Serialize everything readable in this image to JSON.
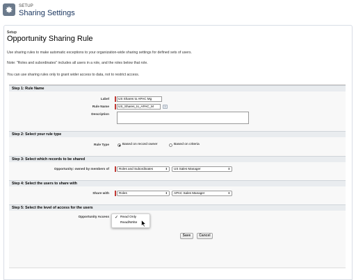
{
  "header": {
    "section": "SETUP",
    "title": "Sharing Settings"
  },
  "page": {
    "setup_label": "Setup",
    "title": "Opportunity Sharing Rule",
    "intro": "Use sharing rules to make automatic exceptions to your organization-wide sharing settings for defined sets of users.",
    "note": "Note: \"Roles and subordinates\" includes all users in a role, and the roles below that role.",
    "grant": "You can use sharing rules only to grant wider access to data, not to restrict access."
  },
  "step1": {
    "heading": "Step 1: Rule Name",
    "label_label": "Label",
    "label_value": "US Shares to APAC Mg",
    "rule_name_label": "Rule Name",
    "rule_name_value": "US_Shares_to_APAC_M",
    "info_icon": "i",
    "description_label": "Description",
    "description_value": ""
  },
  "step2": {
    "heading": "Step 2: Select your rule type",
    "rule_type_label": "Rule Type",
    "option_owner": "Based on record owner",
    "option_criteria": "Based on criteria",
    "selected": "owner"
  },
  "step3": {
    "heading": "Step 3: Select which records to be shared",
    "owned_by_label": "Opportunity: owned by members of",
    "type_value": "Roles and Subordinates",
    "role_value": "US Sales Manager"
  },
  "step4": {
    "heading": "Step 4: Select the users to share with",
    "share_with_label": "Share with",
    "type_value": "Roles",
    "role_value": "APAC Sales Manager"
  },
  "step5": {
    "heading": "Step 5: Select the level of access for the users",
    "access_label": "Opportunity Access",
    "options": [
      "Read Only",
      "Read/Write"
    ],
    "selected": "Read Only"
  },
  "buttons": {
    "save": "Save",
    "cancel": "Cancel"
  },
  "icons": {
    "header_icon": "gear-icon",
    "dropdown_arrow": "chevron-updown-icon",
    "check": "checkmark-icon",
    "cursor": "mouse-pointer-icon"
  },
  "colors": {
    "required": "#c23934",
    "title": "#16325c",
    "section_bg": "#e9ecef"
  }
}
